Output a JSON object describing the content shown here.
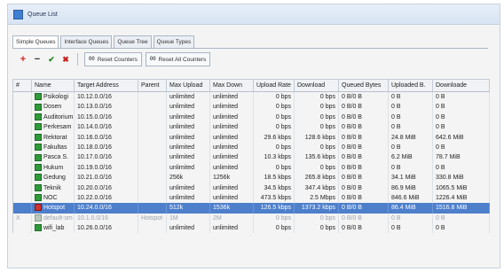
{
  "window": {
    "title": "Queue List"
  },
  "tabs": [
    {
      "label": "Simple Queues"
    },
    {
      "label": "Interface Queues"
    },
    {
      "label": "Queue Tree"
    },
    {
      "label": "Queue Types"
    }
  ],
  "toolbar": {
    "reset_counters": "Reset Counters",
    "reset_all_counters": "Reset All Counters"
  },
  "columns": [
    "#",
    "Name",
    "Target Address",
    "Parent",
    "Max Upload",
    "Max Down",
    "Upload Rate",
    "Download",
    "Queued Bytes",
    "Uploaded B.",
    "Downloade"
  ],
  "rows": [
    {
      "num": "",
      "name": "Psikologi",
      "target": "10.12.0.0/16",
      "parent": "",
      "maxup": "unlimited",
      "maxdn": "unlimited",
      "uprate": "0 bps",
      "dnrate": "0 bps",
      "qbytes": "0 B/0 B",
      "upb": "0 B",
      "dnb": "0 B"
    },
    {
      "num": "",
      "name": "Dosen",
      "target": "10.13.0.0/16",
      "parent": "",
      "maxup": "unlimited",
      "maxdn": "unlimited",
      "uprate": "0 bps",
      "dnrate": "0 bps",
      "qbytes": "0 B/0 B",
      "upb": "0 B",
      "dnb": "0 B"
    },
    {
      "num": "",
      "name": "Auditorium",
      "target": "10.15.0.0/16",
      "parent": "",
      "maxup": "unlimited",
      "maxdn": "unlimited",
      "uprate": "0 bps",
      "dnrate": "0 bps",
      "qbytes": "0 B/0 B",
      "upb": "0 B",
      "dnb": "0 B"
    },
    {
      "num": "",
      "name": "Perkesam",
      "target": "10.14.0.0/16",
      "parent": "",
      "maxup": "unlimited",
      "maxdn": "unlimited",
      "uprate": "0 bps",
      "dnrate": "0 bps",
      "qbytes": "0 B/0 B",
      "upb": "0 B",
      "dnb": "0 B"
    },
    {
      "num": "",
      "name": "Rektorat",
      "target": "10.16.0.0/16",
      "parent": "",
      "maxup": "unlimited",
      "maxdn": "unlimited",
      "uprate": "29.6 kbps",
      "dnrate": "128.6 kbps",
      "qbytes": "0 B/0 B",
      "upb": "24.8 MiB",
      "dnb": "642.6 MiB"
    },
    {
      "num": "",
      "name": "Fakultas",
      "target": "10.18.0.0/16",
      "parent": "",
      "maxup": "unlimited",
      "maxdn": "unlimited",
      "uprate": "0 bps",
      "dnrate": "0 bps",
      "qbytes": "0 B/0 B",
      "upb": "0 B",
      "dnb": "0 B"
    },
    {
      "num": "",
      "name": "Pasca S.",
      "target": "10.17.0.0/16",
      "parent": "",
      "maxup": "unlimited",
      "maxdn": "unlimited",
      "uprate": "10.3 kbps",
      "dnrate": "135.6 kbps",
      "qbytes": "0 B/0 B",
      "upb": "6.2 MiB",
      "dnb": "78.7 MiB"
    },
    {
      "num": "",
      "name": "Hukum",
      "target": "10.19.0.0/16",
      "parent": "",
      "maxup": "unlimited",
      "maxdn": "unlimited",
      "uprate": "0 bps",
      "dnrate": "0 bps",
      "qbytes": "0 B/0 B",
      "upb": "0 B",
      "dnb": "0 B"
    },
    {
      "num": "",
      "name": "Gedung",
      "target": "10.21.0.0/16",
      "parent": "",
      "maxup": "256k",
      "maxdn": "1256k",
      "uprate": "18.5 kbps",
      "dnrate": "265.8 kbps",
      "qbytes": "0 B/0 B",
      "upb": "34.1 MiB",
      "dnb": "330.8 MiB"
    },
    {
      "num": "",
      "name": "Teknik",
      "target": "10.20.0.0/16",
      "parent": "",
      "maxup": "unlimited",
      "maxdn": "unlimited",
      "uprate": "34.5 kbps",
      "dnrate": "347.4 kbps",
      "qbytes": "0 B/0 B",
      "upb": "86.9 MiB",
      "dnb": "1065.5 MiB"
    },
    {
      "num": "",
      "name": "NOC",
      "target": "10.22.0.0/16",
      "parent": "",
      "maxup": "unlimited",
      "maxdn": "unlimited",
      "uprate": "473.5 kbps",
      "dnrate": "2.5 Mbps",
      "qbytes": "0 B/0 B",
      "upb": "846.6 MiB",
      "dnb": "1226.4 MiB"
    },
    {
      "num": "",
      "name": "Hotspot",
      "target": "10.24.0.0/16",
      "parent": "",
      "maxup": "512k",
      "maxdn": "1536k",
      "uprate": "126.5 kbps",
      "dnrate": "1373.2 kbps",
      "qbytes": "0 B/0 B",
      "upb": "86.4 MiB",
      "dnb": "1516.8 MiB"
    },
    {
      "num": "X",
      "name": "default-sm",
      "target": "10.1.0.0/16",
      "parent": "Hotspot",
      "maxup": "1M",
      "maxdn": "2M",
      "uprate": "0 bps",
      "dnrate": "0 bps",
      "qbytes": "0 B/0 B",
      "upb": "0 B",
      "dnb": "0 B"
    },
    {
      "num": "",
      "name": "wifi_lab",
      "target": "10.26.0.0/16",
      "parent": "",
      "maxup": "unlimited",
      "maxdn": "unlimited",
      "uprate": "0 bps",
      "dnrate": "0 bps",
      "qbytes": "0 B/0 B",
      "upb": "0 B",
      "dnb": "0 B"
    }
  ],
  "selected_row": "Hotspot",
  "disabled_row": "default-sm"
}
